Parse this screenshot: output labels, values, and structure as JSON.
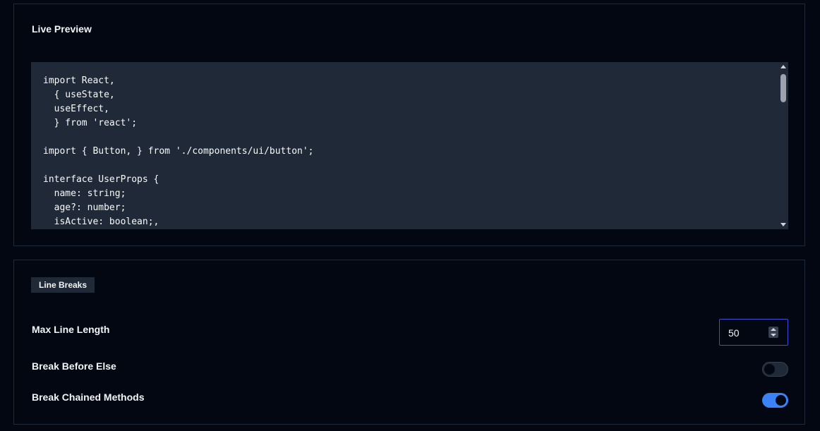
{
  "preview": {
    "title": "Live Preview",
    "code_lines": [
      "import React,",
      "  { useState,",
      "  useEffect,",
      "  } from 'react';",
      "",
      "import { Button, } from './components/ui/button';",
      "",
      "interface UserProps {",
      "  name: string;",
      "  age?: number;",
      "  isActive: boolean;,"
    ]
  },
  "line_breaks": {
    "section_label": "Line Breaks",
    "max_line_length": {
      "label": "Max Line Length",
      "value": "50"
    },
    "break_before_else": {
      "label": "Break Before Else",
      "enabled": false
    },
    "break_chained_methods": {
      "label": "Break Chained Methods",
      "enabled": true
    }
  },
  "colors": {
    "background": "#030712",
    "code_background": "#1f2937",
    "toggle_on": "#3b82f6",
    "input_border_focus": "#3b4fd8"
  },
  "icons": {
    "scroll_up": "triangle-up-icon",
    "scroll_down": "triangle-down-icon",
    "spinner": "stepper-arrows-icon"
  }
}
